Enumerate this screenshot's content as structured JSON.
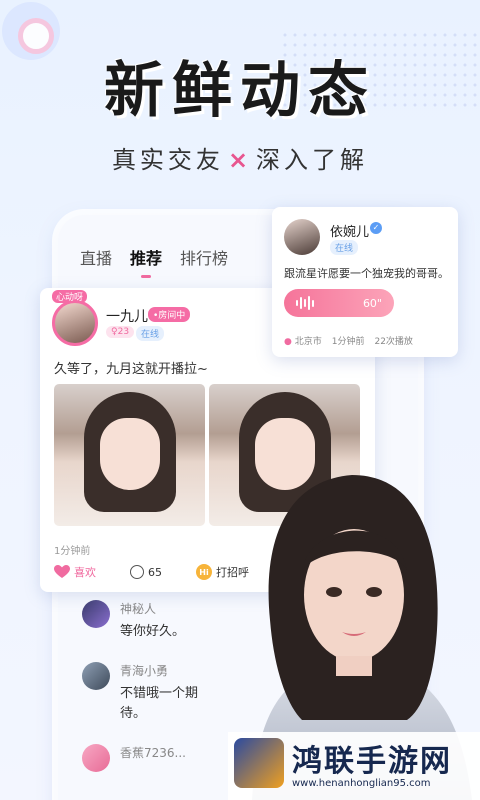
{
  "headline": "新鲜动态",
  "subline": {
    "left": "真实交友",
    "sep": "×",
    "right": "深入了解"
  },
  "tabs": [
    {
      "label": "直播"
    },
    {
      "label": "推荐"
    },
    {
      "label": "排行榜"
    }
  ],
  "post": {
    "avatar_badge": "心动呀",
    "name": "一九儿",
    "live_tag": "•房间中",
    "age_tag": "♀23",
    "online_tag": "在线",
    "text": "久等了，九月这就开播拉~",
    "time": "1分钟前",
    "like_label": "喜欢",
    "comment_count": "65",
    "greet_label": "打招呼",
    "greet_icon": "Hi"
  },
  "profile": {
    "name": "依婉儿",
    "online_tag": "在线",
    "text": "跟流星许愿要一个独宠我的哥哥。",
    "voice_duration": "60\"",
    "location": "北京市",
    "time": "1分钟前",
    "plays": "22次播放"
  },
  "comments": [
    {
      "name": "神秘人",
      "text": "等你好久。"
    },
    {
      "name": "青海小勇",
      "text": "不错哦一个期待。"
    },
    {
      "name": "香蕉7236...",
      "text": ""
    }
  ],
  "watermark": {
    "title": "鸿联手游网",
    "url": "www.henanhonglian95.com"
  },
  "colors": {
    "accent": "#f06ba0",
    "blue": "#5b9df5"
  }
}
